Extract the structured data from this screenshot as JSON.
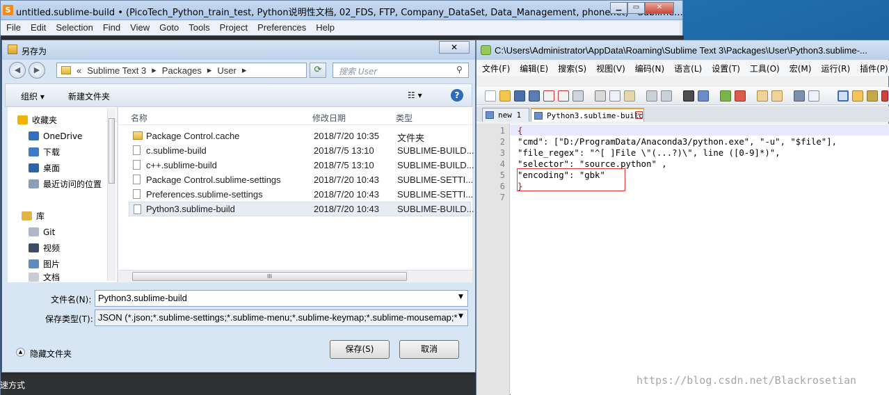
{
  "sublime": {
    "title": "untitled.sublime-build • (PicoTech_Python_train_test, Python说明性文档, 02_FDS, FTP, Company_DataSet, Data_Management, phonenet) - Sublime...",
    "logo": "S",
    "menu": [
      "File",
      "Edit",
      "Selection",
      "Find",
      "View",
      "Goto",
      "Tools",
      "Project",
      "Preferences",
      "Help"
    ],
    "winbtns": [
      "▁",
      "▭",
      "✕"
    ]
  },
  "dialog": {
    "title": "另存为",
    "close": "✕",
    "address": [
      "«",
      "Sublime Text 3",
      "▸",
      "Packages",
      "▸",
      "User",
      "▸"
    ],
    "search_placeholder": "搜索 User",
    "organize": "组织 ▾",
    "new_folder": "新建文件夹",
    "view_icon": "☷ ▾",
    "help_icon": "?",
    "nav": [
      {
        "label": "收藏夹",
        "icon": "star-icon",
        "color": "#f0b400"
      },
      {
        "label": "OneDrive",
        "icon": "cloud-icon",
        "color": "#2f6fc4"
      },
      {
        "label": "下载",
        "icon": "download-folder-icon",
        "color": "#3d7ac8"
      },
      {
        "label": "桌面",
        "icon": "desktop-icon",
        "color": "#2d63a8"
      },
      {
        "label": "最近访问的位置",
        "icon": "recent-places-icon",
        "color": "#8aa0b6"
      },
      {
        "label": "库",
        "icon": "library-icon",
        "color": "#e0b447"
      },
      {
        "label": "Git",
        "icon": "git-icon",
        "color": "#b0b8c4"
      },
      {
        "label": "视频",
        "icon": "video-icon",
        "color": "#3e4d63"
      },
      {
        "label": "图片",
        "icon": "pictures-icon",
        "color": "#5b8dc2"
      },
      {
        "label": "文档",
        "icon": "documents-icon",
        "color": "#c8ccd4"
      }
    ],
    "columns": {
      "name": "名称",
      "date": "修改日期",
      "type": "类型"
    },
    "files": [
      {
        "name": "Package Control.cache",
        "date": "2018/7/20 10:35",
        "type": "文件夹",
        "folder": true
      },
      {
        "name": "c.sublime-build",
        "date": "2018/7/5 13:10",
        "type": "SUBLIME-BUILD..."
      },
      {
        "name": "c++.sublime-build",
        "date": "2018/7/5 13:10",
        "type": "SUBLIME-BUILD..."
      },
      {
        "name": "Package Control.sublime-settings",
        "date": "2018/7/20 10:43",
        "type": "SUBLIME-SETTI..."
      },
      {
        "name": "Preferences.sublime-settings",
        "date": "2018/7/20 10:43",
        "type": "SUBLIME-SETTI..."
      },
      {
        "name": "Python3.sublime-build",
        "date": "2018/7/20 10:43",
        "type": "SUBLIME-BUILD...",
        "selected": true
      }
    ],
    "filename_label": "文件名(N):",
    "filename_value": "Python3.sublime-build",
    "filetype_label": "保存类型(T):",
    "filetype_value": "JSON (*.json;*.sublime-settings;*.sublime-menu;*.sublime-keymap;*.sublime-mousemap;*",
    "hide_folders": "隐藏文件夹",
    "save_button": "保存(S)",
    "cancel_button": "取消",
    "scroll_grip": "III"
  },
  "npp": {
    "title": "C:\\Users\\Administrator\\AppData\\Roaming\\Sublime Text 3\\Packages\\User\\Python3.sublime-...",
    "menu": [
      "文件(F)",
      "编辑(E)",
      "搜索(S)",
      "视图(V)",
      "编码(N)",
      "语言(L)",
      "设置(T)",
      "工具(O)",
      "宏(M)",
      "运行(R)",
      "插件(P)"
    ],
    "tabs": [
      "new 1",
      "Python3.sublime-build"
    ],
    "tab_close": "✕",
    "line_numbers": [
      "1",
      "2",
      "3",
      "4",
      "5",
      "6",
      "7"
    ],
    "code": [
      "{",
      "\"cmd\": [\"D:/ProgramData/Anaconda3/python.exe\", \"-u\", \"$file\"],",
      "\"file_regex\": \"^[ ]File \\\"(...?)\\\", line ([0-9]*)\",",
      "\"selector\": \"source.python\" ,",
      "\"encoding\": \"gbk\"",
      "}",
      ""
    ]
  },
  "watermark": "https://blog.csdn.net/Blackrosetian",
  "taskbar_text": "速方式"
}
